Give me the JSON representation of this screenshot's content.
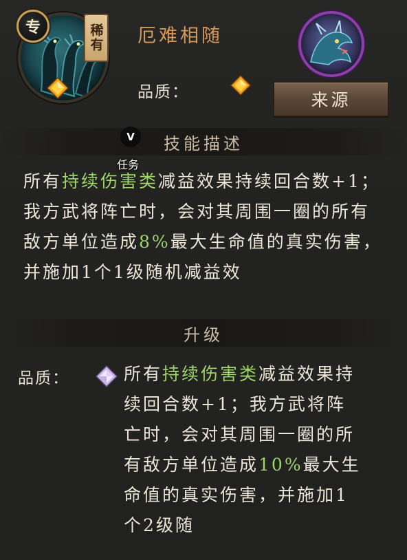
{
  "header": {
    "exclusive_badge": "专",
    "rarity_badge": "稀有",
    "skill_name": "厄难相随",
    "quality_label": "品质：",
    "source_button": "来源",
    "skill_icon": "hydra-skill-icon",
    "hero_portrait": "dragon-portrait",
    "colors": {
      "title": "#d59a5a",
      "highlight": "#9fd66a",
      "portrait_border": "#8c3fa8",
      "rare_badge": "#e2c79a"
    }
  },
  "overlay": {
    "v_badge": "V",
    "task_label": "任务"
  },
  "description": {
    "heading": "技能描述",
    "part1": "所有",
    "highlight1": "持续伤害类",
    "part2": "减益效果持续回合数+1；我方武将阵亡时，会对其周围一圈的所有敌方单位造成",
    "highlight2": "8%",
    "part3": "最大生命值的真实伤害，并施加1个1级随机减益效"
  },
  "upgrade": {
    "heading": "升级",
    "quality_label": "品质：",
    "part1": "所有",
    "highlight1": "持续伤害类",
    "part2": "减益效果持续回合数+1；我方武将阵亡时，会对其周围一圈的所有敌方单位造成",
    "highlight2": "10%",
    "part3": "最大生命值的真实伤害，并施加1个2级随"
  }
}
